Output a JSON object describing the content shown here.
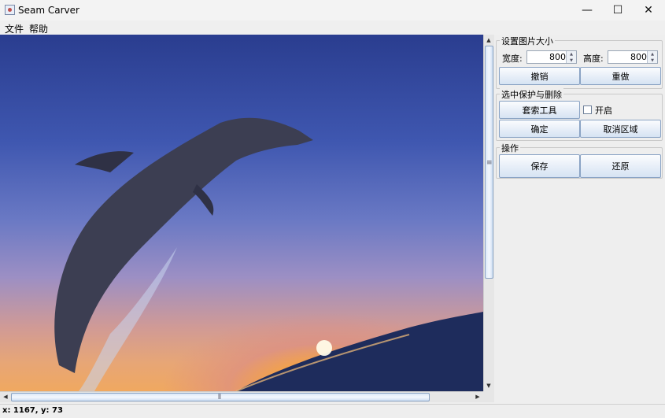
{
  "window": {
    "title": "Seam Carver",
    "minimize": "—",
    "maximize": "☐",
    "close": "✕"
  },
  "menu": {
    "file": "文件",
    "help": "帮助"
  },
  "resize": {
    "title": "设置图片大小",
    "width_label": "宽度:",
    "width_value": "800",
    "height_label": "高度:",
    "height_value": "800",
    "undo": "撤销",
    "redo": "重做"
  },
  "protect": {
    "title": "选中保护与删除",
    "lasso": "套索工具",
    "enable_label": "开启",
    "confirm": "确定",
    "cancel_region": "取消区域"
  },
  "ops": {
    "title": "操作",
    "save": "保存",
    "restore": "还原"
  },
  "status": {
    "coords": "x: 1167, y: 73"
  },
  "scroll": {
    "up": "▲",
    "down": "▼",
    "left": "◀",
    "right": "▶",
    "grip_v": "≡",
    "grip_h": "⦀"
  },
  "icons": {
    "app": "app-icon",
    "spin_up": "▲",
    "spin_down": "▼"
  }
}
